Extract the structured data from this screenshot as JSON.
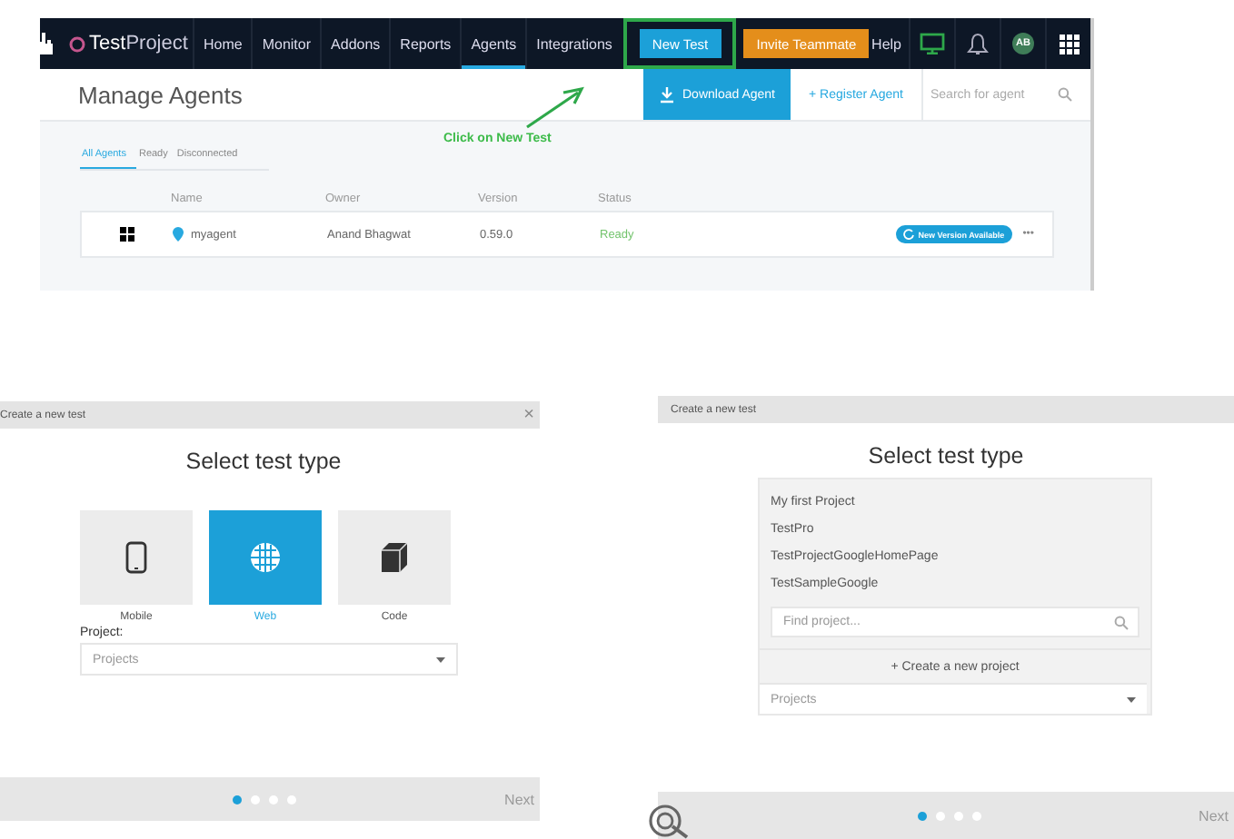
{
  "agents_page": {
    "brand": "**Test**Project",
    "nav": [
      {
        "label": "Home",
        "selected": false
      },
      {
        "label": "Monitor",
        "selected": false
      },
      {
        "label": "Addons",
        "selected": false
      },
      {
        "label": "Reports",
        "selected": false
      },
      {
        "label": "Agents",
        "selected": true
      },
      {
        "label": "Integrations",
        "selected": false
      }
    ],
    "new_test_button": "New Test",
    "invite_button": "Invite Teammate",
    "help": "Help",
    "avatar": "AB",
    "title": "Manage Agents",
    "download_button": "Download Agent",
    "register_button": "+ Register Agent",
    "search": {
      "placeholder": "Search for agent"
    },
    "tabs": [
      {
        "label": "All Agents",
        "selected": true
      },
      {
        "label": "Ready",
        "selected": false
      },
      {
        "label": "Disconnected",
        "selected": false
      }
    ],
    "columns": [
      "Name",
      "Owner",
      "Version",
      "Status"
    ],
    "rows": [
      {
        "name": "myagent",
        "owner": "Anand Bhagwat",
        "version": "0.59.0",
        "status": "Ready",
        "badge": "New Version Available",
        "menu": "•••"
      }
    ]
  },
  "annotation": {
    "text": "Click on New Test"
  },
  "dialogs": [
    {
      "kind": "type_picker",
      "title": "Create a new test",
      "close": "×",
      "heading": "Select test type",
      "types": [
        {
          "label": "Mobile",
          "selected": false
        },
        {
          "label": "Web",
          "selected": true
        },
        {
          "label": "Code",
          "selected": false
        }
      ],
      "project_label": "Project:",
      "project_select": "Projects",
      "steps": [
        {
          "selected": true
        },
        {
          "selected": false
        },
        {
          "selected": false
        },
        {
          "selected": false
        }
      ],
      "next": {
        "label": "Next",
        "disabled": true
      }
    },
    {
      "kind": "project_dropdown",
      "title": "Create a new test",
      "heading": "Select test type",
      "projects": [
        "My first Project",
        "TestPro",
        "TestProjectGoogleHomePage",
        "TestSampleGoogle"
      ],
      "find": {
        "placeholder": "Find project..."
      },
      "create": "+ Create a new project",
      "project_select": "Projects",
      "steps": [
        {
          "selected": true
        },
        {
          "selected": false
        },
        {
          "selected": false
        },
        {
          "selected": false
        }
      ],
      "next": {
        "label": "Next",
        "disabled": true
      }
    }
  ]
}
